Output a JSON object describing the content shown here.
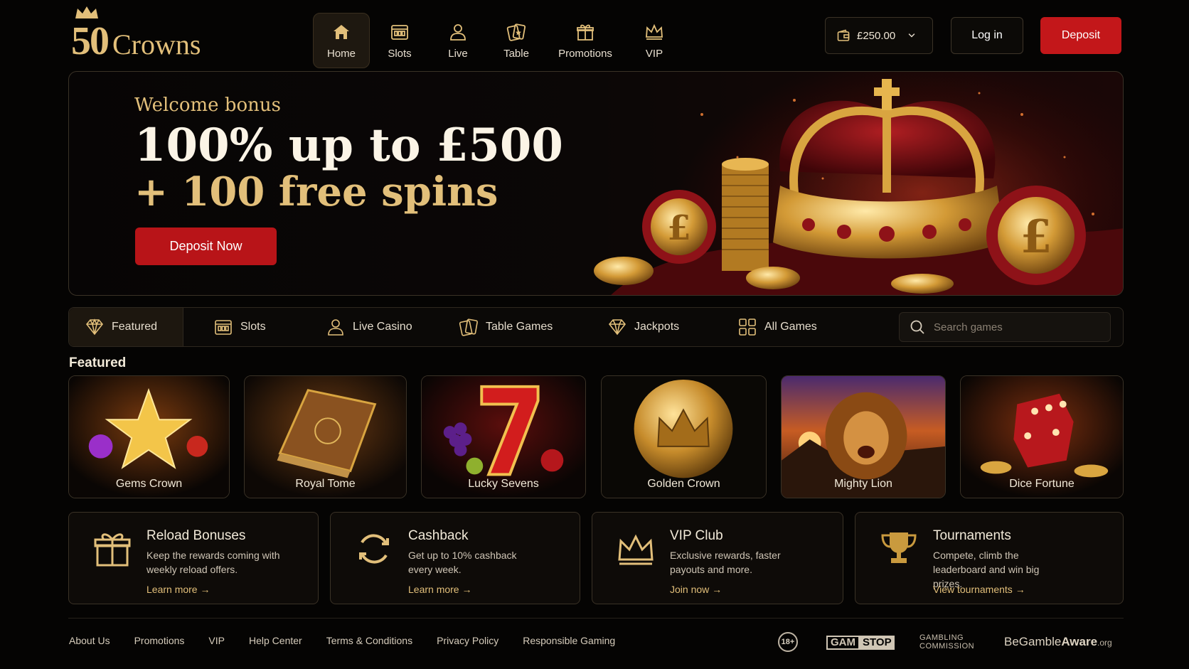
{
  "brand": {
    "number": "50",
    "name": "Crowns",
    "color": "#e2bf7a"
  },
  "nav": [
    {
      "label": "Home",
      "icon": "home-icon",
      "active": true
    },
    {
      "label": "Slots",
      "icon": "slots-icon"
    },
    {
      "label": "Live",
      "icon": "user-icon"
    },
    {
      "label": "Table",
      "icon": "cards-icon"
    },
    {
      "label": "Promotions",
      "icon": "gift-icon"
    },
    {
      "label": "VIP",
      "icon": "crown-icon"
    }
  ],
  "account": {
    "balance": "£250.00",
    "login": "Log in",
    "deposit": "Deposit"
  },
  "hero": {
    "eyebrow": "Welcome bonus",
    "line1": "100% up to £500",
    "line2": "+ 100 free spins",
    "cta": "Deposit Now"
  },
  "categories": [
    {
      "label": "Featured",
      "icon": "diamond-icon",
      "active": true
    },
    {
      "label": "Slots",
      "icon": "slots-icon"
    },
    {
      "label": "Live Casino",
      "icon": "user-icon"
    },
    {
      "label": "Table Games",
      "icon": "cards-icon"
    },
    {
      "label": "Jackpots",
      "icon": "diamond-icon"
    },
    {
      "label": "All Games",
      "icon": "grid-icon"
    }
  ],
  "search": {
    "placeholder": "Search games"
  },
  "featured": {
    "title": "Featured",
    "games": [
      "Gems Crown",
      "Royal Tome",
      "Lucky Sevens",
      "Golden Crown",
      "Mighty Lion",
      "Dice Fortune"
    ]
  },
  "promos": [
    {
      "title": "Reload Bonuses",
      "desc": "Keep the rewards coming with weekly reload offers.",
      "link": "Learn more →",
      "icon": "gift-icon"
    },
    {
      "title": "Cashback",
      "desc": "Get up to 10% cashback every week.",
      "link": "Learn more →",
      "icon": "refresh-icon"
    },
    {
      "title": "VIP Club",
      "desc": "Exclusive rewards, faster payouts and more.",
      "link": "Join now →",
      "icon": "crown-icon"
    },
    {
      "title": "Tournaments",
      "desc": "Compete, climb the leaderboard and win big prizes.",
      "link": "View tournaments →",
      "icon": "trophy-icon"
    }
  ],
  "footer": {
    "links": [
      "About Us",
      "Promotions",
      "VIP",
      "Help Center",
      "Terms & Conditions",
      "Privacy Policy",
      "Responsible Gaming"
    ],
    "age": "18+",
    "gamstop_1": "GAM",
    "gamstop_2": "STOP",
    "commission_1": "GAMBLING",
    "commission_2": "COMMISSION",
    "bga_1": "Be",
    "bga_2": "Gamble",
    "bga_3": "Aware",
    "bga_4": ".org"
  },
  "colors": {
    "accent": "#e2bf7a",
    "cta": "#c3171a",
    "background": "#050403"
  }
}
